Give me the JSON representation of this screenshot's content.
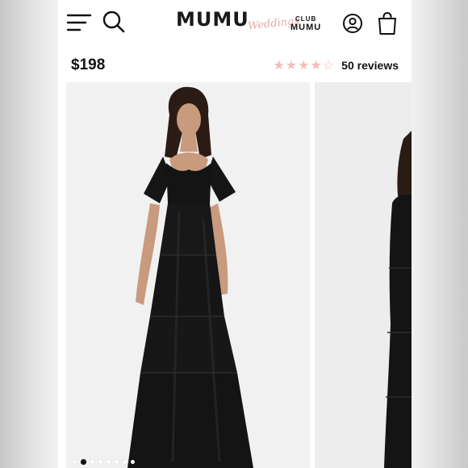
{
  "header": {
    "brand": "MUMU",
    "brand_script": "Weddings",
    "club_top": "CLUB",
    "club_bottom": "MUMU"
  },
  "product": {
    "price": "$198",
    "rating": 4,
    "rating_max": 5,
    "reviews": "50 reviews"
  },
  "gallery": {
    "image_count": 8,
    "active_index": 1
  },
  "colors": {
    "background": "#ffffff",
    "star": "#f3bcb8",
    "brand_script": "#e8a9a4",
    "dress": "#141414"
  },
  "icons": [
    "menu-icon",
    "search-icon",
    "account-icon",
    "cart-icon",
    "star-icon"
  ]
}
